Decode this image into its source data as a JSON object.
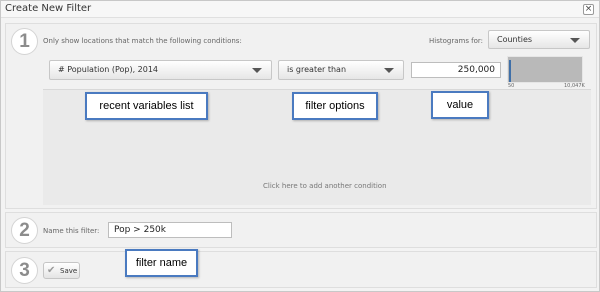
{
  "window": {
    "title": "Create New Filter",
    "close_glyph": "×"
  },
  "step1": {
    "number": "1",
    "instruction": "Only show locations that match the following conditions:",
    "histograms_label": "Histograms for:",
    "histograms_select": "Counties",
    "variable_select": "# Population (Pop), 2014",
    "operator_select": "is greater than",
    "value": "250,000",
    "histogram": {
      "min_label": "50",
      "max_label": "10,047K",
      "highlight_fraction": 0.02
    },
    "add_condition": "Click here to add another condition"
  },
  "step2": {
    "number": "2",
    "label": "Name this filter:",
    "name_value": "Pop > 250k"
  },
  "step3": {
    "number": "3",
    "save_label": "Save",
    "save_icon": "check-icon"
  },
  "callouts": {
    "variables": "recent variables list",
    "options": "filter options",
    "value": "value",
    "name": "filter name"
  },
  "colors": {
    "callout_border": "#4a7ac0",
    "histogram_highlight": "#3f6fa8"
  }
}
